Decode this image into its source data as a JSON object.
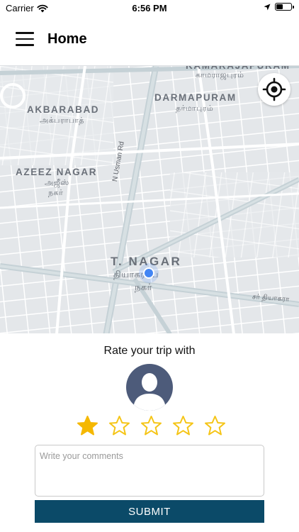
{
  "status_bar": {
    "carrier": "Carrier",
    "time": "6:56 PM"
  },
  "header": {
    "title": "Home"
  },
  "map": {
    "areas": [
      {
        "name": "KAMARAJAPURAM",
        "tamil": "காமராஜபுரம்"
      },
      {
        "name": "DARMAPURAM",
        "tamil": "தர்மாபுரம்"
      },
      {
        "name": "AKBARABAD",
        "tamil": "அக்பராபாத்"
      },
      {
        "name": "AZEEZ NAGAR",
        "tamil": "அஜீஸ்",
        "tamil2": "நகர்"
      },
      {
        "name": "T. NAGAR",
        "tamil": "தியாகராய",
        "tamil2": "நகர்"
      }
    ],
    "roads": [
      {
        "name": "N Usman Rd"
      },
      {
        "name": "சர் தியாகரா"
      }
    ]
  },
  "rating": {
    "title": "Rate your trip with",
    "value": 1,
    "max": 5,
    "filled_color": "#f5b800",
    "empty_color": "#f5c518"
  },
  "comments": {
    "placeholder": "Write your comments"
  },
  "submit": {
    "label": "SUBMIT",
    "color": "#0b4a68"
  }
}
